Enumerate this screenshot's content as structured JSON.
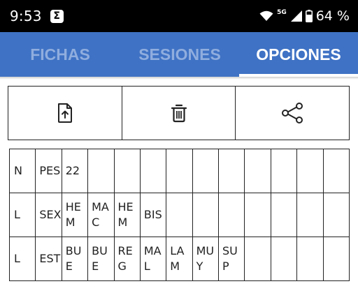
{
  "status_bar": {
    "time": "9:53",
    "notification_icon": "sigma-icon",
    "network": "5G",
    "battery": "64 %"
  },
  "tabs": [
    {
      "label": "FICHAS",
      "active": false
    },
    {
      "label": "SESIONES",
      "active": false
    },
    {
      "label": "OPCIONES",
      "active": true
    }
  ],
  "actions": [
    {
      "icon": "file-upload-icon"
    },
    {
      "icon": "trash-icon"
    },
    {
      "icon": "share-icon"
    }
  ],
  "grid": {
    "rows": [
      [
        "N",
        "PES",
        "22",
        "",
        "",
        "",
        "",
        "",
        "",
        "",
        "",
        "",
        ""
      ],
      [
        "L",
        "SEX",
        "HEM",
        "MAC",
        "HEM",
        "BIS",
        "",
        "",
        "",
        "",
        "",
        "",
        ""
      ],
      [
        "L",
        "EST",
        "BUE",
        "BUE",
        "REG",
        "MAL",
        "LAM",
        "MUY",
        "SUP",
        "",
        "",
        "",
        ""
      ]
    ]
  },
  "colors": {
    "tab_bar": "#3f72c4",
    "tab_inactive": "#8fadde",
    "tab_active": "#ffffff"
  }
}
